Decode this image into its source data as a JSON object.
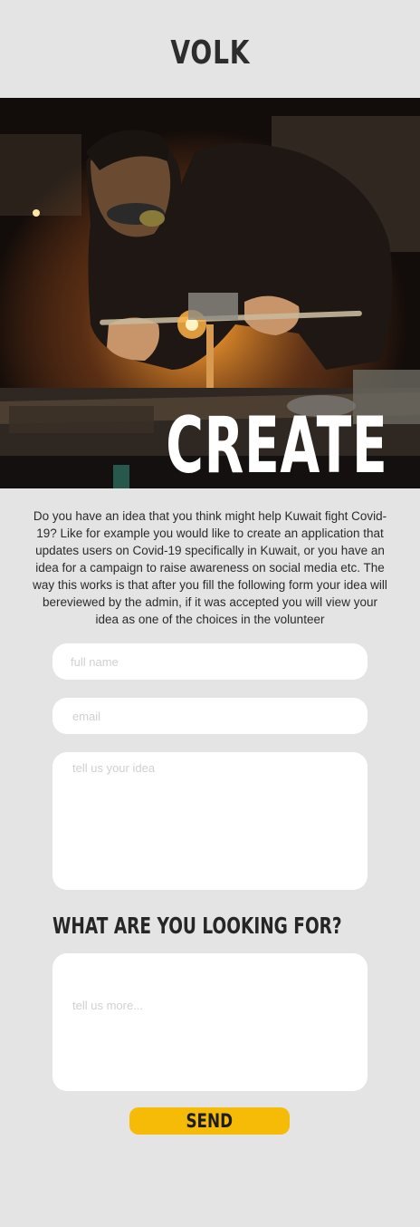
{
  "header": {
    "brand": "VOLK"
  },
  "hero": {
    "title": "CREATE"
  },
  "intro": {
    "text": "Do you have an idea that you think might help Kuwait fight Covid-19? Like for example you would like to create an application that updates users on Covid-19 specifically in Kuwait, or you have an idea for a campaign to raise awareness on social media etc. The way this works is that after you fill the following form your idea will bereviewed by the admin, if it was accepted you will view your idea as one of the choices in the volunteer"
  },
  "form": {
    "name_placeholder": "full name",
    "email_placeholder": "email",
    "idea_placeholder": "tell us your idea",
    "section_title": "WHAT ARE YOU LOOKING FOR?",
    "more_placeholder": "tell us more...",
    "send_label": "SEND"
  },
  "colors": {
    "background": "#e4e4e4",
    "accent": "#f5bb06",
    "field": "#ffffff"
  }
}
